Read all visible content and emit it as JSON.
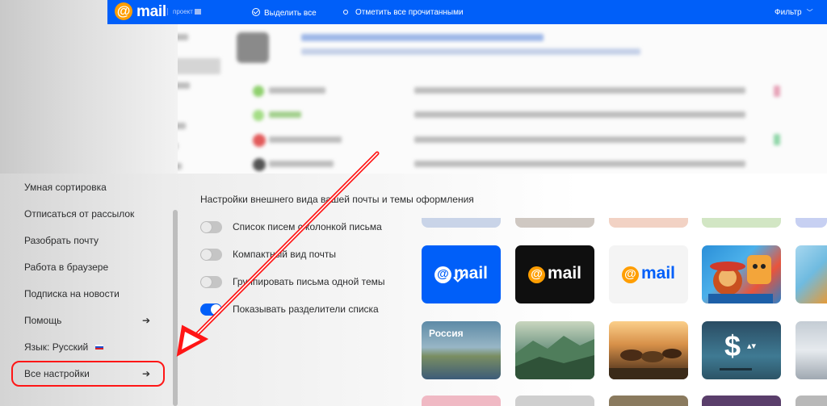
{
  "topbar": {
    "logo_at": "@",
    "logo_word": "mail",
    "logo_project": "проект",
    "select_all_label": "Выделить все",
    "mark_read_label": "Отметить все прочитанными",
    "filter_label": "Фильтр"
  },
  "icons": {
    "select_all": "check-circle-icon",
    "mark_read": "dot-circle-icon",
    "filter": "chevron-down-icon",
    "menu_arrow": "arrow-right-icon",
    "language_flag": "russia-flag-icon"
  },
  "menu": {
    "items": [
      {
        "label": "Умная сортировка"
      },
      {
        "label": "Отписаться от рассылок"
      },
      {
        "label": "Разобрать почту"
      },
      {
        "label": "Работа в браузере"
      },
      {
        "label": "Подписка на новости"
      },
      {
        "label": "Помощь",
        "arrow": "➔"
      },
      {
        "label": "Язык: Русский"
      },
      {
        "label": "Все настройки",
        "arrow": "➔"
      }
    ]
  },
  "settings": {
    "title": "Настройки внешнего вида вашей почты и темы оформления",
    "options": [
      {
        "label": "Список писем с колонкой письма",
        "enabled": false
      },
      {
        "label": "Компактный вид почты",
        "enabled": false
      },
      {
        "label": "Группировать письма одной темы",
        "enabled": false
      },
      {
        "label": "Показывать разделители списка",
        "enabled": true
      }
    ]
  },
  "themes": {
    "tile_logo_at": "@",
    "tile_logo_word": "mail",
    "russia_label": "Россия",
    "dollar_sign": "$",
    "dollar_arrows": "▴▾"
  },
  "colors": {
    "brand_blue": "#005ff9",
    "brand_orange": "#ff9e00",
    "highlight_red": "#ff1616"
  }
}
